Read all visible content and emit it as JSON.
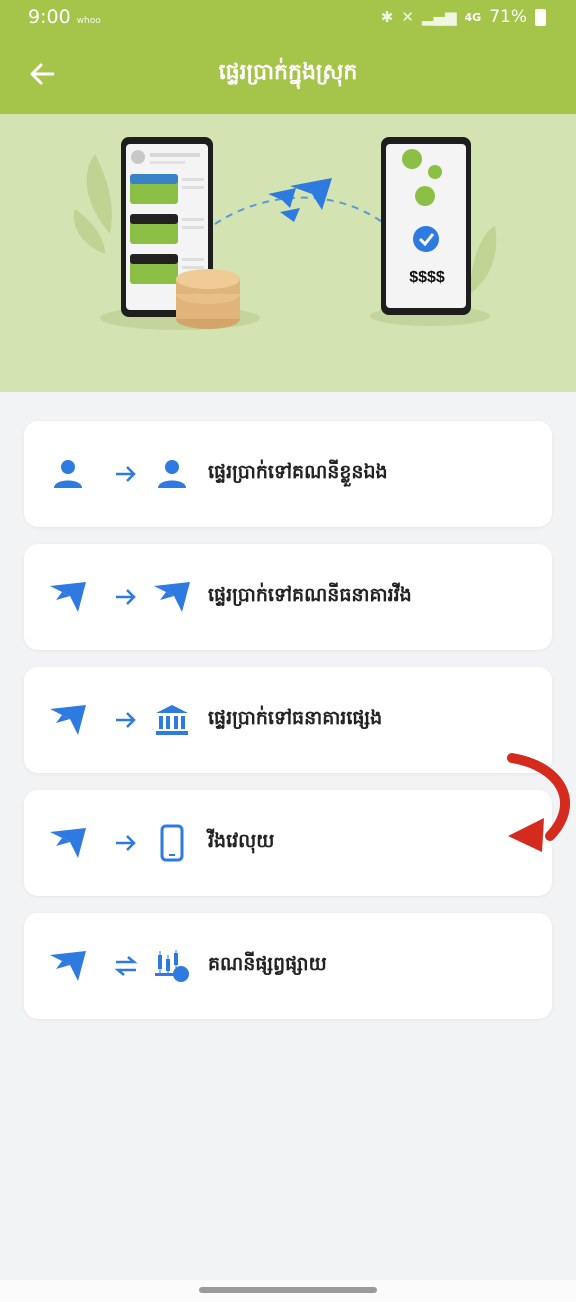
{
  "status_bar": {
    "time": "9:00",
    "carrier": "whoo",
    "network": "4G",
    "battery": "71%"
  },
  "app_bar": {
    "title": "ផ្ទេរប្រាក់ក្នុងស្រុក",
    "back_icon": "arrow-left-icon"
  },
  "banner": {
    "amount_text": "$$$$"
  },
  "menu": {
    "items": [
      {
        "label": "ផ្ទេរប្រាក់ទៅគណនីខ្លួនឯង",
        "from_icon": "user-icon",
        "arrow_icon": "arrow-right-icon",
        "to_icon": "user-icon"
      },
      {
        "label": "ផ្ទេរប្រាក់ទៅគណនីធនាគារវីង",
        "from_icon": "wing-bird-icon",
        "arrow_icon": "arrow-right-icon",
        "to_icon": "wing-bird-icon"
      },
      {
        "label": "ផ្ទេរប្រាក់ទៅធនាគារផ្សេង",
        "from_icon": "wing-bird-icon",
        "arrow_icon": "arrow-right-icon",
        "to_icon": "bank-icon"
      },
      {
        "label": "វីងវេលុយ",
        "from_icon": "wing-bird-icon",
        "arrow_icon": "arrow-right-icon",
        "to_icon": "phone-icon"
      },
      {
        "label": "គណនីផ្សព្វផ្សាយ",
        "from_icon": "wing-bird-icon",
        "arrow_icon": "swap-arrows-icon",
        "to_icon": "trading-chart-icon"
      }
    ]
  },
  "colors": {
    "header_green": "#a5c44a",
    "banner_green": "#d4e3b2",
    "icon_blue": "#2e7ae0",
    "annotation_red": "#d42b1e"
  }
}
